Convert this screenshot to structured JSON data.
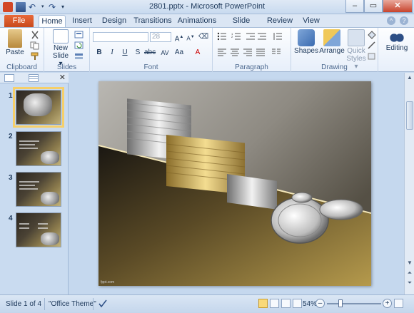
{
  "window": {
    "title": "2801.pptx - Microsoft PowerPoint",
    "controls": {
      "minimize": "–",
      "maximize": "▭",
      "close": "✕"
    }
  },
  "tabs": [
    "File",
    "Home",
    "Insert",
    "Design",
    "Transitions",
    "Animations",
    "Slide Show",
    "Review",
    "View"
  ],
  "ribbon": {
    "clipboard": {
      "label": "Clipboard",
      "paste": "Paste"
    },
    "slides": {
      "label": "Slides",
      "new_slide_1": "New",
      "new_slide_2": "Slide ▾"
    },
    "font": {
      "label": "Font",
      "font_name": "",
      "font_size": "28"
    },
    "paragraph": {
      "label": "Paragraph"
    },
    "drawing": {
      "label": "Drawing",
      "shapes": "Shapes",
      "arrange": "Arrange",
      "quick_styles_1": "Quick",
      "quick_styles_2": "Styles ▾"
    },
    "editing": {
      "label": "Editing"
    }
  },
  "slides_pane": {
    "numbers": [
      "1",
      "2",
      "3",
      "4"
    ],
    "selected": 1
  },
  "slide": {
    "footer": "fppt.com"
  },
  "status": {
    "slide_info": "Slide 1 of 4",
    "theme": "\"Office Theme\"",
    "zoom": "54%"
  },
  "colors": {
    "file_tab": "#c84a1c",
    "accent_gold": "#f0c858",
    "ribbon_bg": "#e7effa"
  }
}
